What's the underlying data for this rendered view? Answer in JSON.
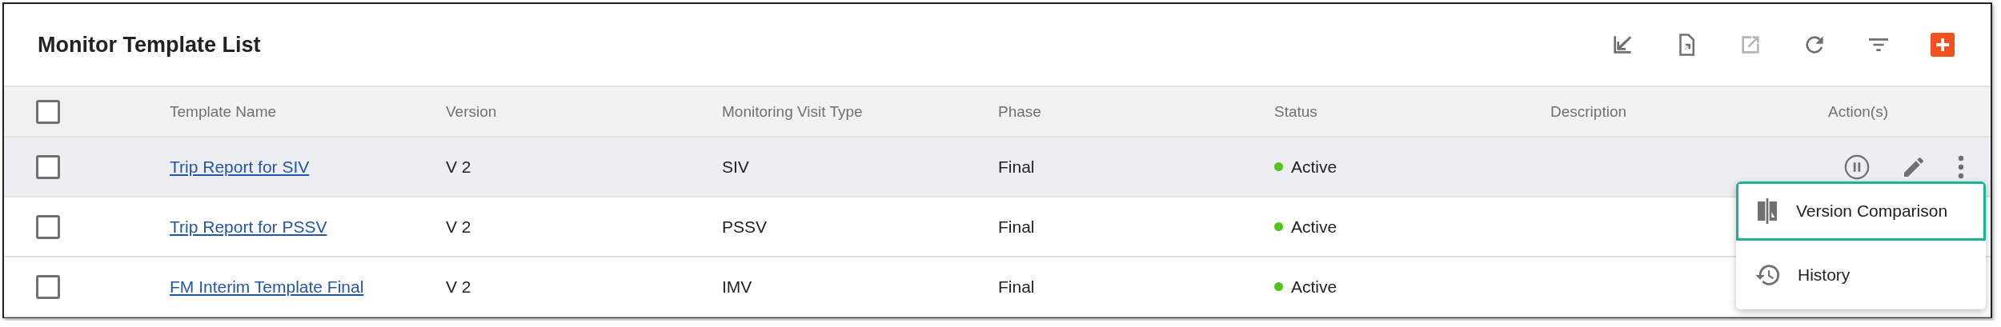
{
  "title": "Monitor Template List",
  "toolbar": [
    {
      "kind": "import",
      "disabled": false
    },
    {
      "kind": "file-export",
      "disabled": false
    },
    {
      "kind": "export",
      "disabled": true
    },
    {
      "kind": "refresh",
      "disabled": false
    },
    {
      "kind": "filter",
      "disabled": false
    },
    {
      "kind": "add",
      "disabled": false
    }
  ],
  "table": {
    "select_all": {
      "checked": false
    },
    "columns": [
      "Template Name",
      "Version",
      "Monitoring Visit Type",
      "Phase",
      "Status",
      "Description",
      "Action(s)"
    ],
    "rows": [
      {
        "checked": false,
        "highlighted": true,
        "name": "Trip Report for SIV",
        "version": "V 2",
        "visit_type": "SIV",
        "phase": "Final",
        "status": "Active"
      },
      {
        "checked": false,
        "highlighted": false,
        "name": "Trip Report for PSSV",
        "version": "V 2",
        "visit_type": "PSSV",
        "phase": "Final",
        "status": "Active"
      },
      {
        "checked": false,
        "highlighted": false,
        "name": "FM Interim Template Final",
        "version": "V 2",
        "visit_type": "IMV",
        "phase": "Final",
        "status": "Active"
      }
    ]
  },
  "menu": [
    {
      "kind": "compare",
      "label": "Version Comparison",
      "highlighted": true
    },
    {
      "kind": "history",
      "label": "History",
      "highlighted": false
    }
  ]
}
